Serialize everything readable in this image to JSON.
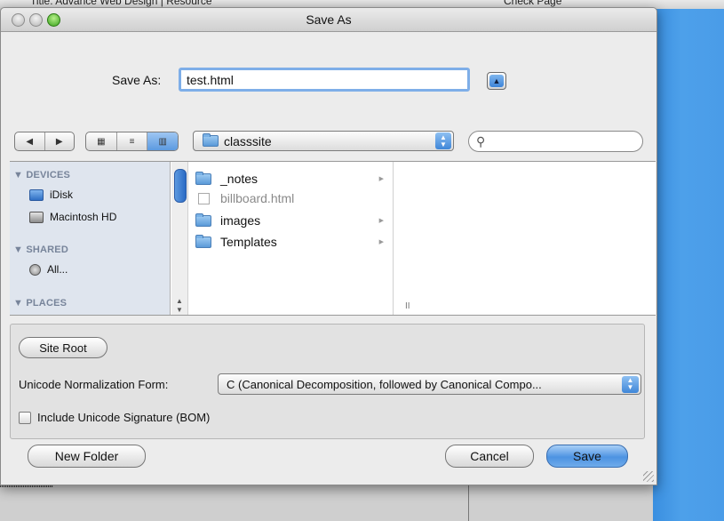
{
  "background_app": {
    "toolbar_text": "Title:  Advance Web Design | Resource",
    "check_page": "Check Page"
  },
  "dialog": {
    "title": "Save As",
    "save_as_label": "Save As:",
    "filename_value": "test.html",
    "expand_glyph": "▲",
    "nav": {
      "back": "◀",
      "forward": "▶"
    },
    "views": {
      "icon": "▦",
      "list": "≡",
      "column": "▥"
    },
    "location": "classsite",
    "search_glyph": "⚲",
    "sidebar": {
      "devices_header": "▼ DEVICES",
      "devices": [
        "iDisk",
        "Macintosh HD"
      ],
      "shared_header": "▼ SHARED",
      "shared": [
        "All..."
      ],
      "places_header": "▼ PLACES"
    },
    "files": [
      {
        "name": "_notes",
        "kind": "folder",
        "dim": false
      },
      {
        "name": "billboard.html",
        "kind": "file",
        "dim": true
      },
      {
        "name": "images",
        "kind": "folder",
        "dim": false
      },
      {
        "name": "Templates",
        "kind": "folder",
        "dim": false
      }
    ],
    "column_resize_glyph": "II",
    "options": {
      "site_root": "Site Root",
      "unicode_label": "Unicode Normalization Form:",
      "unicode_value": "C (Canonical Decomposition, followed by Canonical Compo...",
      "bom_label": "Include Unicode Signature (BOM)",
      "bom_checked": false
    },
    "buttons": {
      "new_folder": "New Folder",
      "cancel": "Cancel",
      "save": "Save"
    }
  },
  "colors": {
    "accent": "#4d93e2",
    "desktop_blue": "#4a9ce8",
    "sidebar_bg": "#dfe5ee"
  }
}
